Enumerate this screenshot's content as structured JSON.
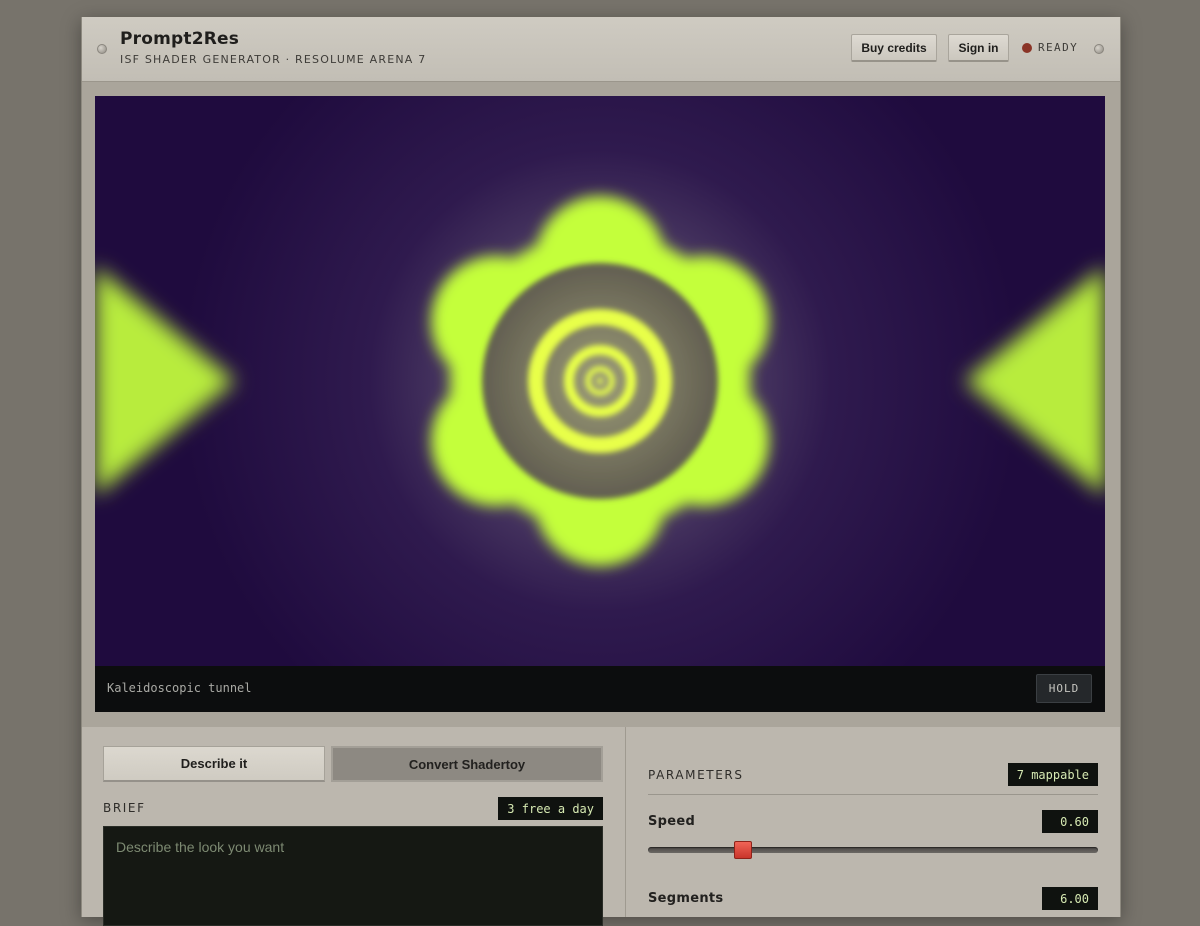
{
  "header": {
    "title": "Prompt2Res",
    "subtitle": "ISF SHADER GENERATOR · RESOLUME ARENA 7",
    "buy_credits_label": "Buy credits",
    "sign_in_label": "Sign in",
    "status_text": "READY",
    "status_color": "#8a3426"
  },
  "preview": {
    "preset_name": "Kaleidoscopic tunnel",
    "hold_label": "HOLD",
    "background_color": "#1f0b3e",
    "accent_color": "#c4ff3a"
  },
  "brief_panel": {
    "tabs": [
      {
        "label": "Describe it",
        "active": true
      },
      {
        "label": "Convert Shadertoy",
        "active": false
      }
    ],
    "section_label": "BRIEF",
    "quota_chip": "3 free a day",
    "brief_placeholder": "Describe the look you want",
    "brief_value": ""
  },
  "parameters_panel": {
    "section_label": "PARAMETERS",
    "mappable_chip": "7 mappable",
    "params": [
      {
        "label": "Speed",
        "value": "0.60",
        "fraction": 0.21
      },
      {
        "label": "Segments",
        "value": "6.00"
      }
    ]
  }
}
